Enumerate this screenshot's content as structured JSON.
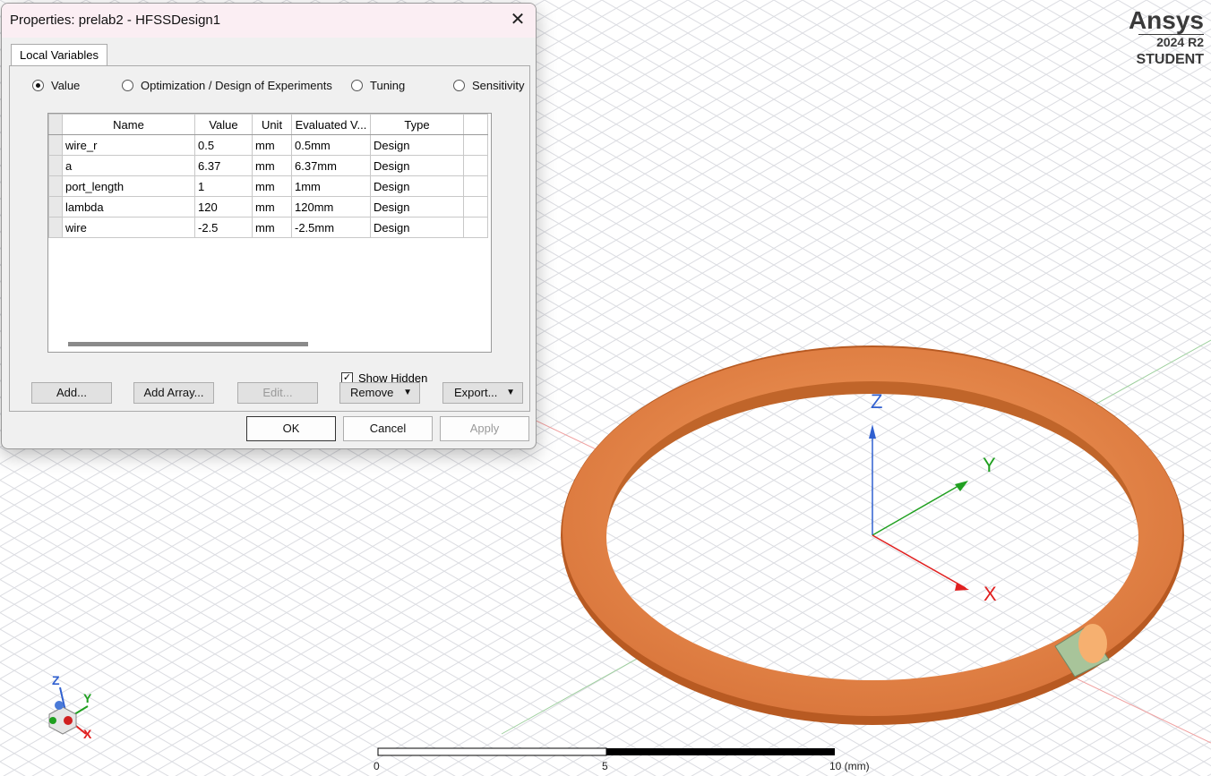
{
  "dialog": {
    "title": "Properties: prelab2 - HFSSDesign1",
    "close_glyph": "✕",
    "tab_label": "Local Variables",
    "radios": [
      {
        "label": "Value",
        "selected": true
      },
      {
        "label": "Optimization / Design of Experiments",
        "selected": false
      },
      {
        "label": "Tuning",
        "selected": false
      },
      {
        "label": "Sensitivity",
        "selected": false
      }
    ],
    "table": {
      "headers": [
        "Name",
        "Value",
        "Unit",
        "Evaluated V...",
        "Type"
      ],
      "rows": [
        [
          "wire_r",
          "0.5",
          "mm",
          "0.5mm",
          "Design"
        ],
        [
          "a",
          "6.37",
          "mm",
          "6.37mm",
          "Design"
        ],
        [
          "port_length",
          "1",
          "mm",
          "1mm",
          "Design"
        ],
        [
          "lambda",
          "120",
          "mm",
          "120mm",
          "Design"
        ],
        [
          "wire",
          "-2.5",
          "mm",
          "-2.5mm",
          "Design"
        ]
      ]
    },
    "show_hidden_label": "Show Hidden",
    "show_hidden_checked": true,
    "buttons": {
      "add": "Add...",
      "add_array": "Add Array...",
      "edit": "Edit...",
      "remove": "Remove",
      "export": "Export...",
      "ok": "OK",
      "cancel": "Cancel",
      "apply": "Apply"
    }
  },
  "brand": {
    "name": "Ansys",
    "version": "2024 R2",
    "edition": "STUDENT"
  },
  "viewport": {
    "axis_labels": {
      "x": "X",
      "y": "Y",
      "z": "Z"
    },
    "scale_labels": [
      "0",
      "5",
      "10 (mm)"
    ],
    "colors": {
      "ring": "#e88040",
      "x_axis": "#e02020",
      "y_axis": "#20a020",
      "z_axis": "#3060d0"
    }
  }
}
